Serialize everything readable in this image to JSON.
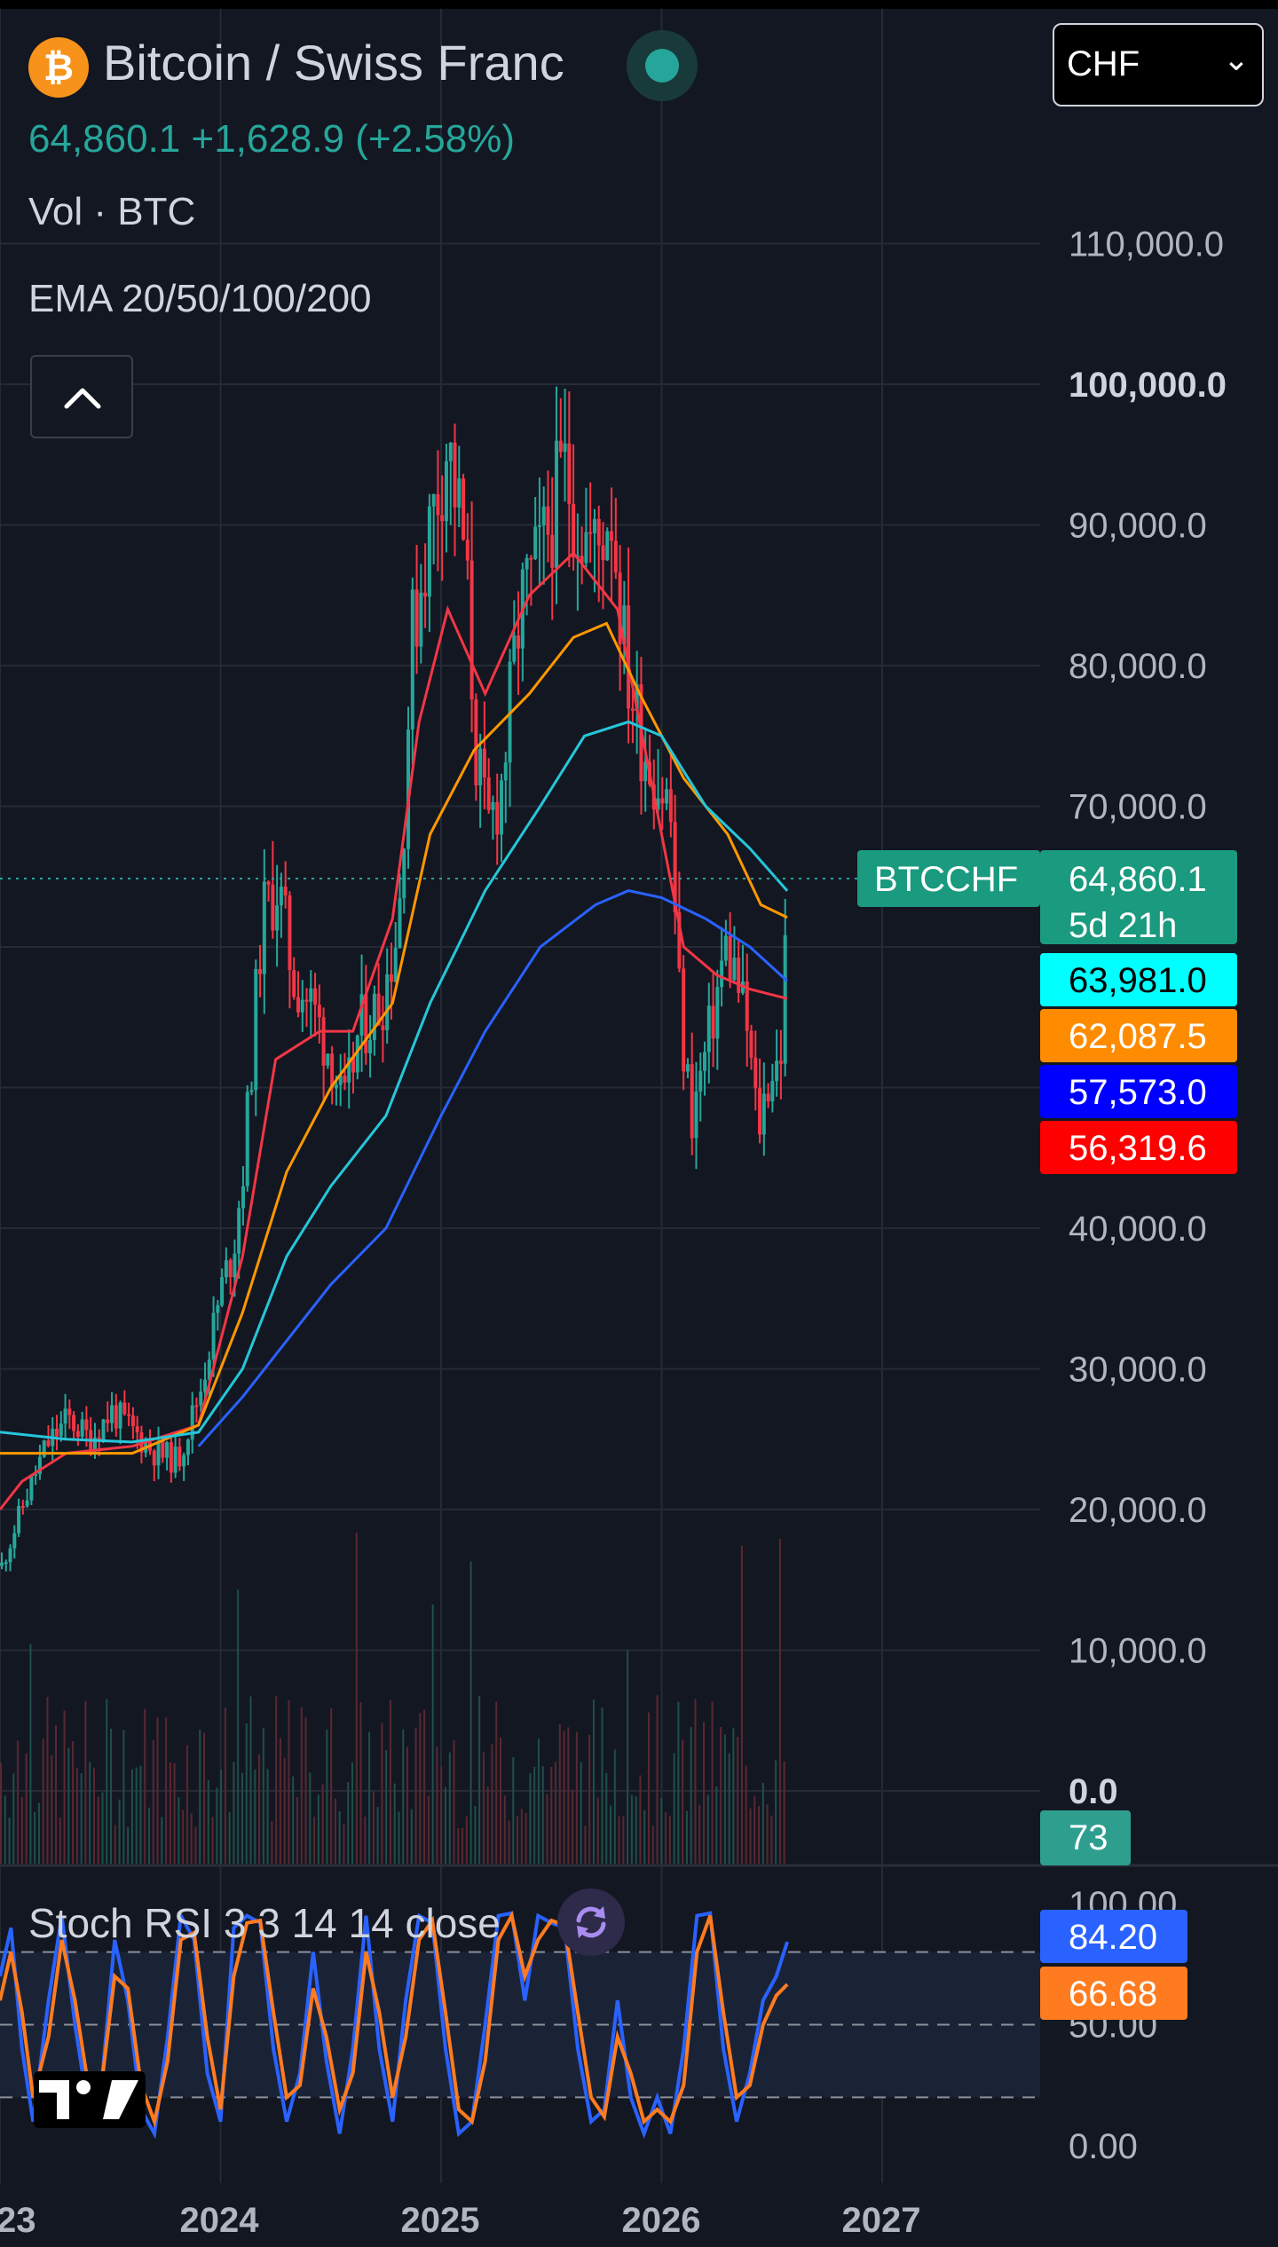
{
  "header": {
    "logo_glyph": "₿",
    "title": "Bitcoin / Swiss Franc",
    "price_line": "64,860.1  +1,628.9 (+2.58%)",
    "vol_label": "Vol · BTC",
    "ema_label": "EMA 20/50/100/200",
    "currency": "CHF"
  },
  "icons": {
    "logo": "bitcoin-icon",
    "status": "market-status-icon",
    "collapse": "chevron-up-icon",
    "dropdown": "chevron-down-icon",
    "refresh": "refresh-icon",
    "brand": "tradingview-logo"
  },
  "stoch_panel": {
    "label": "Stoch RSI 3 3 14 14 close",
    "k_value": "84.20",
    "d_value": "66.68",
    "axis_ticks": [
      "100.00",
      "50.00",
      "0.00"
    ]
  },
  "chart_data": {
    "type": "candlestick",
    "symbol": "BTCCHF",
    "interval": "weekly",
    "x_ticks": [
      "23",
      "2024",
      "2025",
      "2026",
      "2027"
    ],
    "y_ticks": [
      "110,000.0",
      "100,000.0",
      "90,000.0",
      "80,000.0",
      "70,000.0",
      "40,000.0",
      "30,000.0",
      "20,000.0",
      "10,000.0",
      "0.0"
    ],
    "ylim": [
      0,
      115000
    ],
    "last_price": 64860.1,
    "last_price_label": "64,860.1",
    "countdown": "5d 21h",
    "volume_label": "73",
    "price_path": [
      [
        2023.0,
        16000
      ],
      [
        2023.1,
        20500
      ],
      [
        2023.2,
        24500
      ],
      [
        2023.3,
        26500
      ],
      [
        2023.4,
        25000
      ],
      [
        2023.5,
        27000
      ],
      [
        2023.6,
        25500
      ],
      [
        2023.7,
        24000
      ],
      [
        2023.8,
        23500
      ],
      [
        2023.9,
        28500
      ],
      [
        2024.0,
        36000
      ],
      [
        2024.05,
        38500
      ],
      [
        2024.1,
        45000
      ],
      [
        2024.18,
        62000
      ],
      [
        2024.25,
        64500
      ],
      [
        2024.32,
        58000
      ],
      [
        2024.4,
        56000
      ],
      [
        2024.5,
        52000
      ],
      [
        2024.55,
        48000
      ],
      [
        2024.62,
        54000
      ],
      [
        2024.72,
        56000
      ],
      [
        2024.8,
        62000
      ],
      [
        2024.86,
        82000
      ],
      [
        2024.92,
        88000
      ],
      [
        2024.97,
        92000
      ],
      [
        2025.02,
        96000
      ],
      [
        2025.1,
        88000
      ],
      [
        2025.15,
        74000
      ],
      [
        2025.2,
        68000
      ],
      [
        2025.27,
        72000
      ],
      [
        2025.35,
        84000
      ],
      [
        2025.45,
        88000
      ],
      [
        2025.55,
        94000
      ],
      [
        2025.62,
        90000
      ],
      [
        2025.7,
        88000
      ],
      [
        2025.76,
        92000
      ],
      [
        2025.83,
        80000
      ],
      [
        2025.9,
        75000
      ],
      [
        2025.97,
        72000
      ],
      [
        2026.03,
        70000
      ],
      [
        2026.08,
        54000
      ],
      [
        2026.13,
        48000
      ],
      [
        2026.2,
        53000
      ],
      [
        2026.28,
        60000
      ],
      [
        2026.33,
        58000
      ],
      [
        2026.38,
        54000
      ],
      [
        2026.43,
        47000
      ],
      [
        2026.48,
        51000
      ],
      [
        2026.53,
        52000
      ],
      [
        2026.57,
        64860
      ]
    ],
    "series": [
      {
        "name": "EMA 20",
        "color": "#f23645",
        "last_label": "56,319.6",
        "points": [
          [
            2023.0,
            20000
          ],
          [
            2023.1,
            22000
          ],
          [
            2023.3,
            24000
          ],
          [
            2023.6,
            24500
          ],
          [
            2023.9,
            26000
          ],
          [
            2024.1,
            38000
          ],
          [
            2024.25,
            52000
          ],
          [
            2024.45,
            54000
          ],
          [
            2024.6,
            54000
          ],
          [
            2024.78,
            62000
          ],
          [
            2024.9,
            76000
          ],
          [
            2025.03,
            84000
          ],
          [
            2025.2,
            78000
          ],
          [
            2025.4,
            85000
          ],
          [
            2025.6,
            88000
          ],
          [
            2025.8,
            84000
          ],
          [
            2025.95,
            72000
          ],
          [
            2026.1,
            60000
          ],
          [
            2026.25,
            58000
          ],
          [
            2026.4,
            57000
          ],
          [
            2026.57,
            56319.6
          ]
        ]
      },
      {
        "name": "EMA 50",
        "color": "#ff9800",
        "last_label": "62,087.5",
        "points": [
          [
            2023.0,
            24000
          ],
          [
            2023.3,
            24000
          ],
          [
            2023.6,
            24000
          ],
          [
            2023.9,
            26000
          ],
          [
            2024.1,
            34000
          ],
          [
            2024.3,
            44000
          ],
          [
            2024.5,
            50000
          ],
          [
            2024.78,
            56000
          ],
          [
            2024.95,
            68000
          ],
          [
            2025.15,
            74000
          ],
          [
            2025.4,
            78000
          ],
          [
            2025.6,
            82000
          ],
          [
            2025.75,
            83000
          ],
          [
            2025.9,
            78000
          ],
          [
            2026.1,
            72000
          ],
          [
            2026.3,
            68000
          ],
          [
            2026.45,
            63000
          ],
          [
            2026.57,
            62087.5
          ]
        ]
      },
      {
        "name": "EMA 100",
        "color": "#26c6da",
        "last_label": "63,981.0",
        "points": [
          [
            2023.0,
            25500
          ],
          [
            2023.3,
            25000
          ],
          [
            2023.6,
            24800
          ],
          [
            2023.9,
            25500
          ],
          [
            2024.1,
            30000
          ],
          [
            2024.3,
            38000
          ],
          [
            2024.5,
            43000
          ],
          [
            2024.75,
            48000
          ],
          [
            2024.95,
            56000
          ],
          [
            2025.2,
            64000
          ],
          [
            2025.45,
            70000
          ],
          [
            2025.65,
            75000
          ],
          [
            2025.85,
            76000
          ],
          [
            2026.0,
            75000
          ],
          [
            2026.2,
            70000
          ],
          [
            2026.4,
            67000
          ],
          [
            2026.57,
            63981.0
          ]
        ]
      },
      {
        "name": "EMA 200",
        "color": "#2962ff",
        "last_label": "57,573.0",
        "points": [
          [
            2023.9,
            24500
          ],
          [
            2024.1,
            28000
          ],
          [
            2024.3,
            32000
          ],
          [
            2024.5,
            36000
          ],
          [
            2024.75,
            40000
          ],
          [
            2025.0,
            48000
          ],
          [
            2025.2,
            54000
          ],
          [
            2025.45,
            60000
          ],
          [
            2025.7,
            63000
          ],
          [
            2025.85,
            64000
          ],
          [
            2026.0,
            63500
          ],
          [
            2026.2,
            62000
          ],
          [
            2026.4,
            60000
          ],
          [
            2026.57,
            57573.0
          ]
        ]
      }
    ],
    "stoch_k": [
      [
        2023.0,
        70
      ],
      [
        2023.05,
        90
      ],
      [
        2023.1,
        40
      ],
      [
        2023.15,
        10
      ],
      [
        2023.22,
        60
      ],
      [
        2023.28,
        95
      ],
      [
        2023.34,
        50
      ],
      [
        2023.4,
        15
      ],
      [
        2023.46,
        25
      ],
      [
        2023.52,
        85
      ],
      [
        2023.58,
        60
      ],
      [
        2023.64,
        15
      ],
      [
        2023.7,
        5
      ],
      [
        2023.76,
        45
      ],
      [
        2023.82,
        95
      ],
      [
        2023.88,
        85
      ],
      [
        2023.94,
        30
      ],
      [
        2024.0,
        10
      ],
      [
        2024.06,
        90
      ],
      [
        2024.12,
        95
      ],
      [
        2024.18,
        92
      ],
      [
        2024.24,
        40
      ],
      [
        2024.3,
        10
      ],
      [
        2024.36,
        30
      ],
      [
        2024.42,
        80
      ],
      [
        2024.48,
        35
      ],
      [
        2024.54,
        5
      ],
      [
        2024.6,
        40
      ],
      [
        2024.66,
        95
      ],
      [
        2024.72,
        40
      ],
      [
        2024.78,
        10
      ],
      [
        2024.84,
        60
      ],
      [
        2024.9,
        95
      ],
      [
        2024.96,
        92
      ],
      [
        2025.02,
        40
      ],
      [
        2025.08,
        5
      ],
      [
        2025.14,
        10
      ],
      [
        2025.2,
        50
      ],
      [
        2025.26,
        95
      ],
      [
        2025.32,
        96
      ],
      [
        2025.38,
        60
      ],
      [
        2025.44,
        95
      ],
      [
        2025.5,
        92
      ],
      [
        2025.56,
        90
      ],
      [
        2025.62,
        40
      ],
      [
        2025.68,
        10
      ],
      [
        2025.74,
        15
      ],
      [
        2025.8,
        60
      ],
      [
        2025.86,
        20
      ],
      [
        2025.92,
        5
      ],
      [
        2025.98,
        20
      ],
      [
        2026.04,
        5
      ],
      [
        2026.1,
        40
      ],
      [
        2026.16,
        95
      ],
      [
        2026.22,
        96
      ],
      [
        2026.28,
        40
      ],
      [
        2026.34,
        10
      ],
      [
        2026.4,
        30
      ],
      [
        2026.46,
        60
      ],
      [
        2026.52,
        70
      ],
      [
        2026.57,
        84.2
      ]
    ],
    "stoch_d": [
      [
        2023.0,
        60
      ],
      [
        2023.05,
        80
      ],
      [
        2023.1,
        55
      ],
      [
        2023.15,
        20
      ],
      [
        2023.22,
        45
      ],
      [
        2023.28,
        85
      ],
      [
        2023.34,
        60
      ],
      [
        2023.4,
        25
      ],
      [
        2023.46,
        25
      ],
      [
        2023.52,
        70
      ],
      [
        2023.58,
        65
      ],
      [
        2023.64,
        25
      ],
      [
        2023.7,
        10
      ],
      [
        2023.76,
        35
      ],
      [
        2023.82,
        85
      ],
      [
        2023.88,
        88
      ],
      [
        2023.94,
        45
      ],
      [
        2024.0,
        15
      ],
      [
        2024.06,
        70
      ],
      [
        2024.12,
        92
      ],
      [
        2024.18,
        93
      ],
      [
        2024.24,
        55
      ],
      [
        2024.3,
        20
      ],
      [
        2024.36,
        25
      ],
      [
        2024.42,
        65
      ],
      [
        2024.48,
        45
      ],
      [
        2024.54,
        15
      ],
      [
        2024.6,
        30
      ],
      [
        2024.66,
        80
      ],
      [
        2024.72,
        55
      ],
      [
        2024.78,
        20
      ],
      [
        2024.84,
        45
      ],
      [
        2024.9,
        85
      ],
      [
        2024.96,
        93
      ],
      [
        2025.02,
        55
      ],
      [
        2025.08,
        15
      ],
      [
        2025.14,
        10
      ],
      [
        2025.2,
        35
      ],
      [
        2025.26,
        85
      ],
      [
        2025.32,
        95
      ],
      [
        2025.38,
        70
      ],
      [
        2025.44,
        85
      ],
      [
        2025.5,
        93
      ],
      [
        2025.56,
        91
      ],
      [
        2025.62,
        55
      ],
      [
        2025.68,
        20
      ],
      [
        2025.74,
        12
      ],
      [
        2025.8,
        45
      ],
      [
        2025.86,
        30
      ],
      [
        2025.92,
        10
      ],
      [
        2025.98,
        15
      ],
      [
        2026.04,
        10
      ],
      [
        2026.1,
        25
      ],
      [
        2026.16,
        80
      ],
      [
        2026.22,
        95
      ],
      [
        2026.28,
        55
      ],
      [
        2026.34,
        20
      ],
      [
        2026.4,
        25
      ],
      [
        2026.46,
        50
      ],
      [
        2026.52,
        62
      ],
      [
        2026.57,
        66.68
      ]
    ]
  },
  "colors": {
    "background": "#131722",
    "grid": "#262a35",
    "up": "#26a69a",
    "down": "#f23645",
    "price_tag": "#1a9a7e",
    "stoch_k": "#2962ff",
    "stoch_d": "#ff7b20",
    "ema100_tag": "#00ffff",
    "ema50_tag": "#ff8c00",
    "ema200_tag": "#0000ff",
    "ema20_tag": "#ff0000"
  }
}
